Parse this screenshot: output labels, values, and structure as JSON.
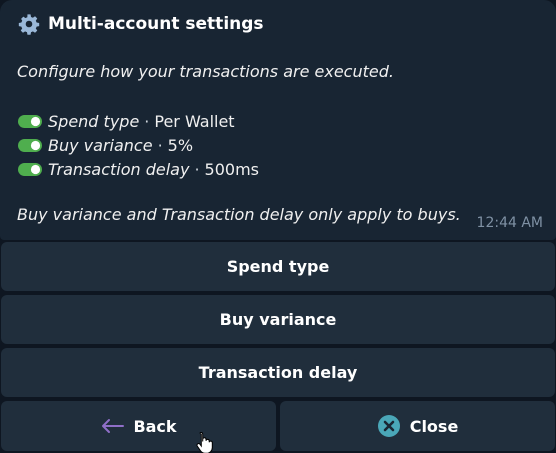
{
  "message": {
    "title": "Multi-account settings",
    "title_icon": "gear-icon",
    "intro": "Configure how your transactions are executed.",
    "settings": [
      {
        "label": "Spend type",
        "value": "Per Wallet",
        "enabled": true
      },
      {
        "label": "Buy variance",
        "value": "5%",
        "enabled": true
      },
      {
        "label": "Transaction delay",
        "value": "500ms",
        "enabled": true
      }
    ],
    "separator": "·",
    "footnote": "Buy variance and Transaction delay only apply to buys.",
    "timestamp": "12:44 AM"
  },
  "keyboard": {
    "spend_type": "Spend type",
    "buy_variance": "Buy variance",
    "transaction_delay": "Transaction delay",
    "back": "Back",
    "back_icon": "arrow-left-icon",
    "close": "Close",
    "close_icon": "close-circle-icon"
  },
  "colors": {
    "background": "#0e1621",
    "bubble": "#182533",
    "button": "#202e3c",
    "toggle_on": "#4fae4e",
    "back_arrow": "#8f6fc8",
    "close_icon_bg": "#4aa7b8",
    "timestamp": "#7f91a4"
  }
}
